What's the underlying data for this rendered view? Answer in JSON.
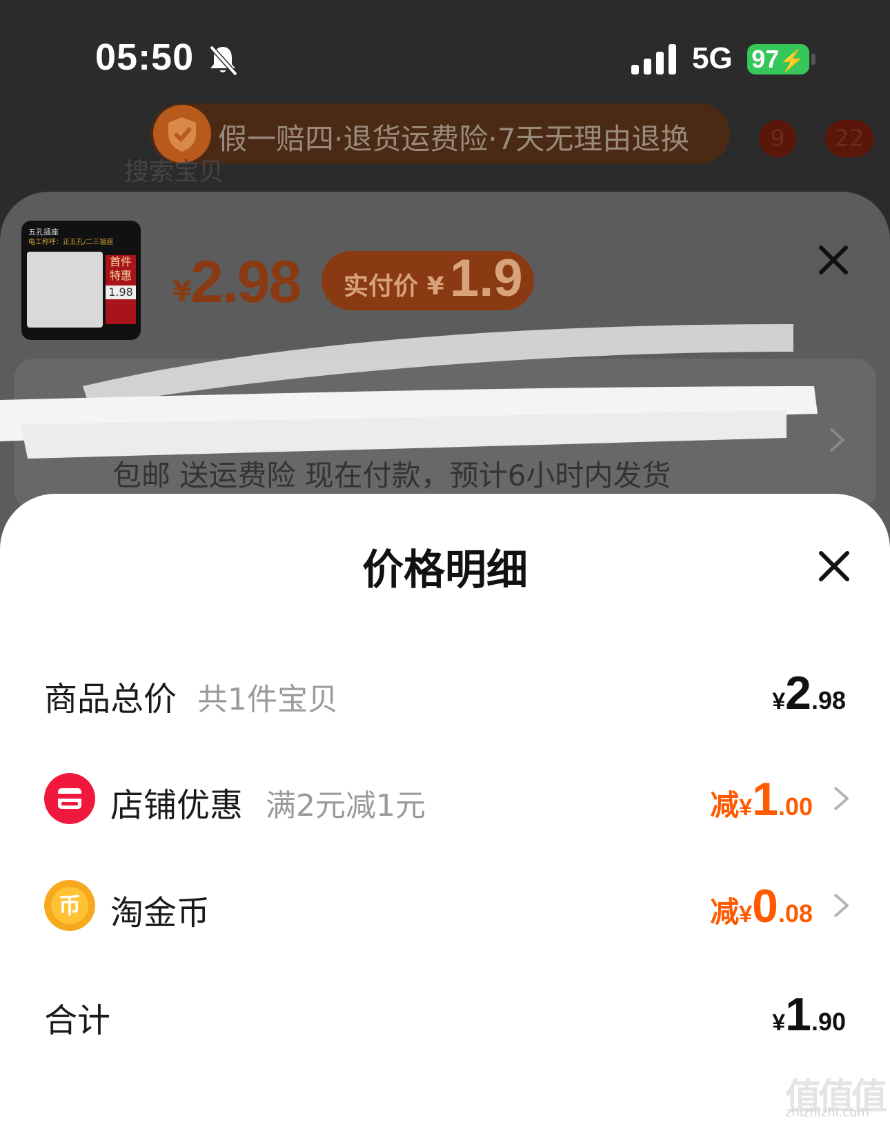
{
  "status_bar": {
    "time": "05:50",
    "network": "5G",
    "battery": "97"
  },
  "background": {
    "guarantee_banner": "假一赔四·退货运费险·7天无理由退换",
    "badges": [
      "9",
      "22"
    ],
    "search_placeholder": "搜索宝贝",
    "product_thumb_line1": "五孔插座",
    "product_thumb_line2": "电工称呼：正五孔/二三插座",
    "product_thumb_tag": "首件特惠",
    "product_thumb_price": "1.98",
    "product_price_symbol": "¥",
    "product_price": "2.98",
    "actual_price_label": "实付价",
    "actual_price_symbol": "¥",
    "actual_price": "1.9",
    "shipping_text": "包邮 送运费险 现在付款，预计6小时内发货"
  },
  "price_sheet": {
    "title": "价格明细",
    "rows": [
      {
        "label": "商品总价",
        "sub": "共1件宝贝",
        "prefix": "",
        "yen": "¥",
        "int": "2",
        "dec": ".98"
      },
      {
        "label": "店铺优惠",
        "sub": "满2元减1元",
        "prefix": "减",
        "yen": "¥",
        "int": "1",
        "dec": ".00"
      },
      {
        "label": "淘金币",
        "sub": "",
        "prefix": "减",
        "yen": "¥",
        "int": "0",
        "dec": ".08"
      },
      {
        "label": "合计",
        "sub": "",
        "prefix": "",
        "yen": "¥",
        "int": "1",
        "dec": ".90"
      }
    ]
  },
  "icons": {
    "shop": "shop-icon",
    "coin": "coin-icon",
    "coin_glyph": "币",
    "close": "close-icon",
    "chevron": "chevron-right-icon"
  },
  "colors": {
    "accent": "#ff5a00",
    "shop_icon": "#f0183d",
    "coin_icon": "#f6a91c",
    "battery": "#35c759"
  },
  "watermark": {
    "text": "值值值",
    "url": "zhizhizhi.com"
  }
}
